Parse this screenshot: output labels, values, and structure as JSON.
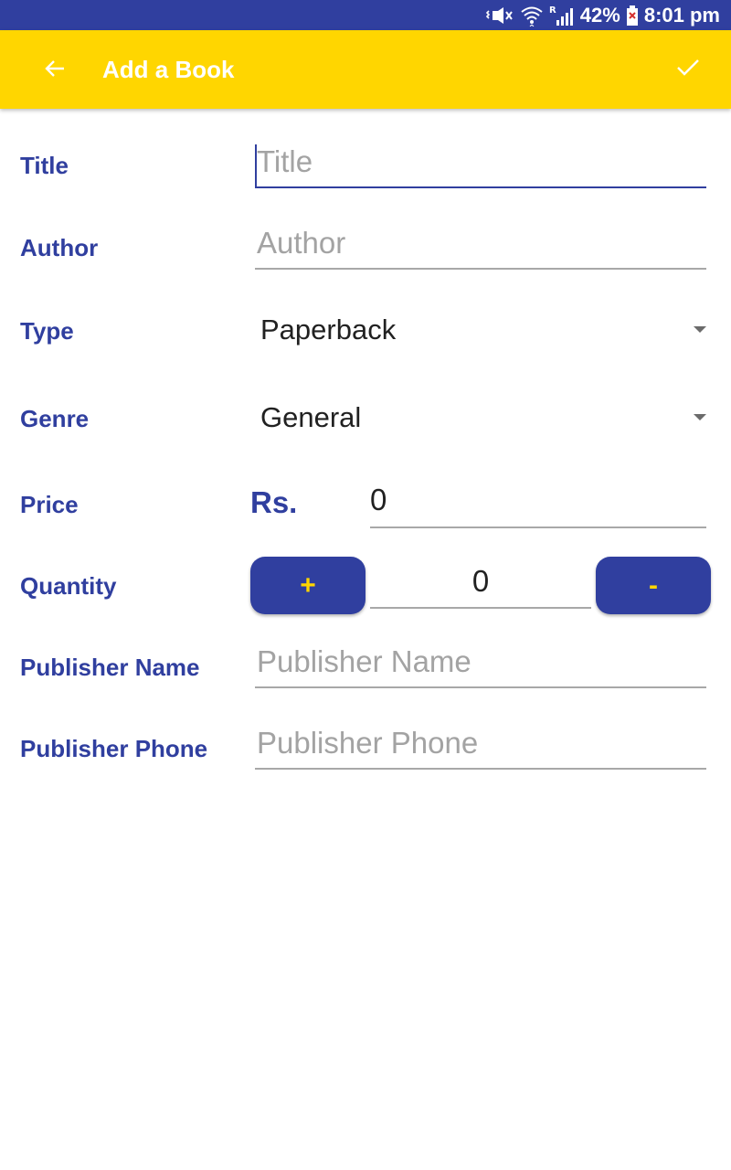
{
  "status_bar": {
    "battery": "42%",
    "time": "8:01 pm",
    "icons": [
      "vibrate-icon",
      "wifi-icon",
      "roaming-signal-icon",
      "battery-icon"
    ]
  },
  "app_bar": {
    "title": "Add a Book",
    "back_icon": "arrow-back-icon",
    "save_icon": "check-icon",
    "background_color": "#ffd600"
  },
  "form": {
    "title": {
      "label": "Title",
      "value": "",
      "placeholder": "Title"
    },
    "author": {
      "label": "Author",
      "value": "",
      "placeholder": "Author"
    },
    "type": {
      "label": "Type",
      "selected": "Paperback"
    },
    "genre": {
      "label": "Genre",
      "selected": "General"
    },
    "price": {
      "label": "Price",
      "currency": "Rs.",
      "value": "0"
    },
    "quantity": {
      "label": "Quantity",
      "increment_label": "+",
      "decrement_label": "-",
      "value": "0"
    },
    "publisher_name": {
      "label": "Publisher Name",
      "value": "",
      "placeholder": "Publisher Name"
    },
    "publisher_phone": {
      "label": "Publisher Phone",
      "value": "",
      "placeholder": "Publisher Phone"
    }
  },
  "colors": {
    "primary": "#303f9f",
    "accent": "#ffd600",
    "hint": "#a3a3a3"
  }
}
